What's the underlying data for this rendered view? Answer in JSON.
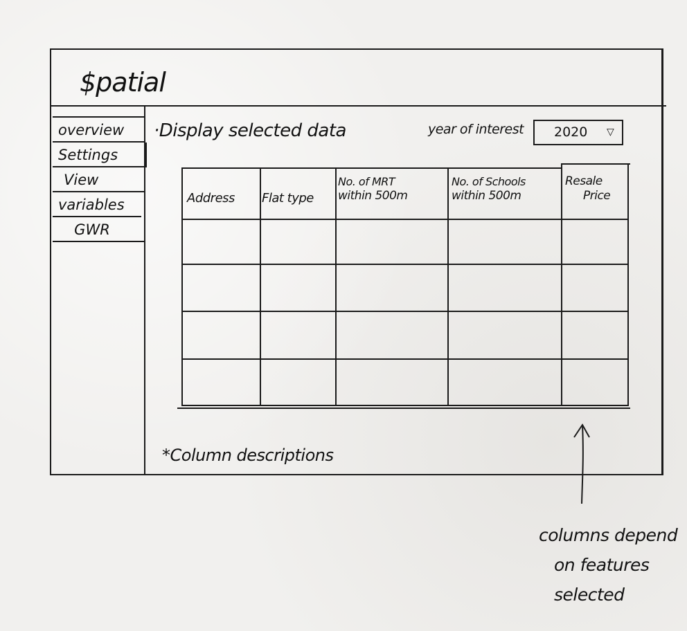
{
  "app": {
    "title": "$patial"
  },
  "sidebar": {
    "items": [
      {
        "label": "overview"
      },
      {
        "label": "Settings"
      },
      {
        "label": "View"
      },
      {
        "label": "variables"
      },
      {
        "label": "GWR"
      }
    ]
  },
  "main": {
    "section_title": "·Display selected data",
    "year_label": "year of interest",
    "year_value": "2020",
    "year_arrow": "▽",
    "table": {
      "headers": [
        {
          "line1": "",
          "line2": "Address"
        },
        {
          "line1": "",
          "line2": "Flat type"
        },
        {
          "line1": "No. of MRT",
          "line2": "within 500m"
        },
        {
          "line1": "No. of Schools",
          "line2": "within 500m"
        },
        {
          "line1": "Resale",
          "line2": "Price"
        }
      ]
    },
    "footnote": "*Column descriptions"
  },
  "annotation": {
    "line1": "columns depend",
    "line2": "on features",
    "line3": "selected"
  }
}
